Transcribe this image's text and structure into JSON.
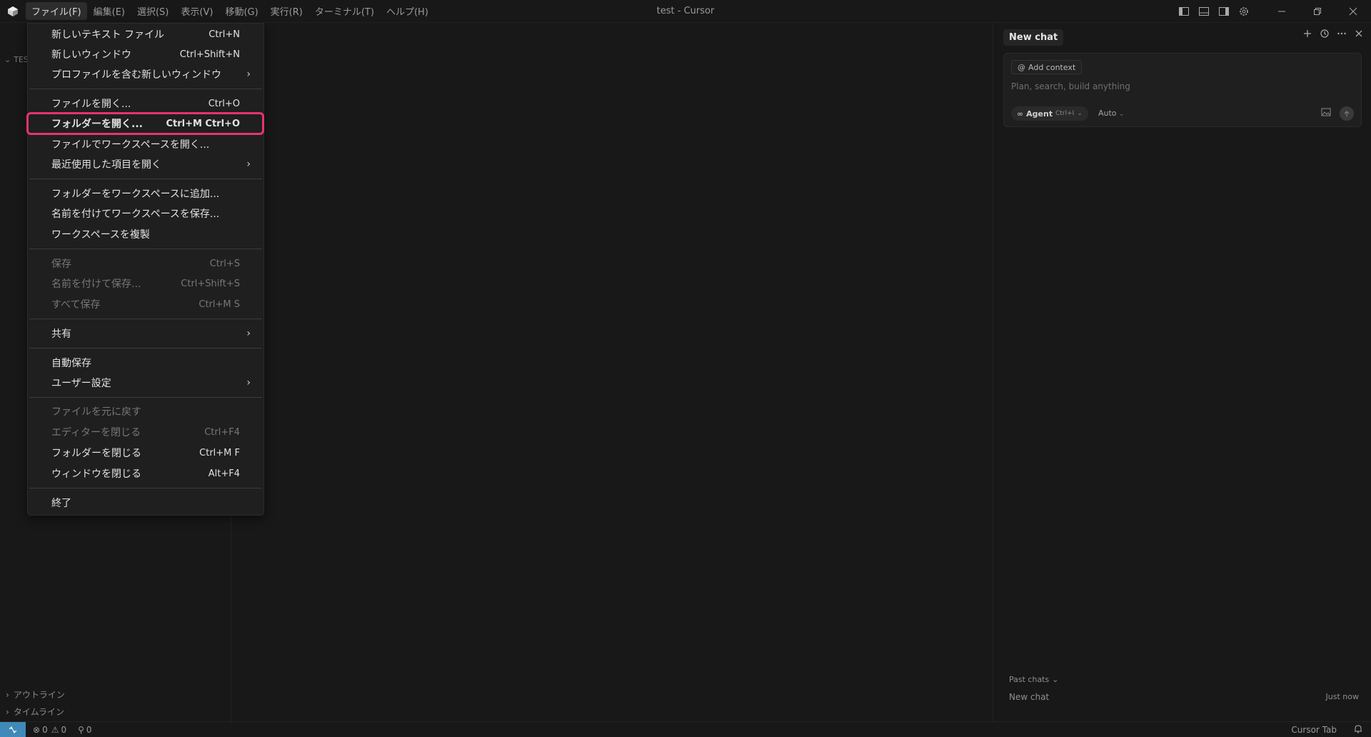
{
  "titlebar": {
    "window_title": "test - Cursor",
    "menus": [
      "ファイル(F)",
      "編集(E)",
      "選択(S)",
      "表示(V)",
      "移動(G)",
      "実行(R)",
      "ターミナル(T)",
      "ヘルプ(H)"
    ]
  },
  "sidebar": {
    "explorer_label": "TES",
    "outline_label": "アウトライン",
    "timeline_label": "タイムライン"
  },
  "file_menu": {
    "items": [
      {
        "label": "新しいテキスト ファイル",
        "shortcut": "Ctrl+N"
      },
      {
        "label": "新しいウィンドウ",
        "shortcut": "Ctrl+Shift+N"
      },
      {
        "label": "プロファイルを含む新しいウィンドウ",
        "shortcut": ""
      },
      {
        "label": "ファイルを開く...",
        "shortcut": "Ctrl+O"
      },
      {
        "label": "フォルダーを開く...",
        "shortcut": "Ctrl+M Ctrl+O"
      },
      {
        "label": "ファイルでワークスペースを開く...",
        "shortcut": ""
      },
      {
        "label": "最近使用した項目を開く",
        "shortcut": ""
      },
      {
        "label": "フォルダーをワークスペースに追加...",
        "shortcut": ""
      },
      {
        "label": "名前を付けてワークスペースを保存...",
        "shortcut": ""
      },
      {
        "label": "ワークスペースを複製",
        "shortcut": ""
      },
      {
        "label": "保存",
        "shortcut": "Ctrl+S"
      },
      {
        "label": "名前を付けて保存...",
        "shortcut": "Ctrl+Shift+S"
      },
      {
        "label": "すべて保存",
        "shortcut": "Ctrl+M S"
      },
      {
        "label": "共有",
        "shortcut": ""
      },
      {
        "label": "自動保存",
        "shortcut": ""
      },
      {
        "label": "ユーザー設定",
        "shortcut": ""
      },
      {
        "label": "ファイルを元に戻す",
        "shortcut": ""
      },
      {
        "label": "エディターを閉じる",
        "shortcut": "Ctrl+F4"
      },
      {
        "label": "フォルダーを閉じる",
        "shortcut": "Ctrl+M F"
      },
      {
        "label": "ウィンドウを閉じる",
        "shortcut": "Alt+F4"
      },
      {
        "label": "終了",
        "shortcut": ""
      }
    ]
  },
  "chat": {
    "tab_title": "New chat",
    "add_context_label": "Add context",
    "input_placeholder": "Plan, search, build anything",
    "agent_label": "Agent",
    "agent_shortcut": "Ctrl+I",
    "model_label": "Auto",
    "past_chats_label": "Past chats",
    "past_chat_title": "New chat",
    "past_chat_time": "Just now"
  },
  "statusbar": {
    "errors": "0",
    "warnings": "0",
    "ports": "0",
    "cursor_tab_label": "Cursor Tab"
  },
  "colors": {
    "highlight": "#e8336e",
    "remote_button": "#3f8ab8",
    "background": "#181818"
  }
}
